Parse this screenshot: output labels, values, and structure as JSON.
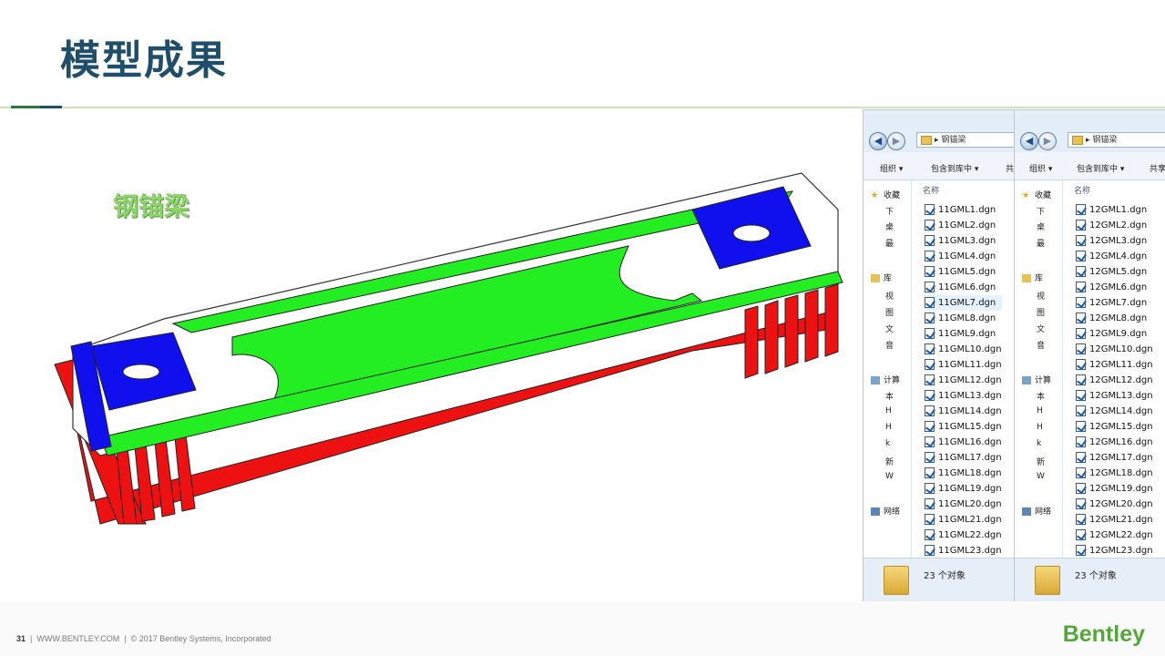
{
  "slide": {
    "title": "模型成果",
    "model_label": "钢锚梁",
    "footer": {
      "page": "31",
      "site": "WWW.BENTLEY.COM",
      "copyright": "© 2017 Bentley Systems, Incorporated"
    },
    "brand": "Bentley"
  },
  "colors": {
    "title": "#1f4e6b",
    "green_plate": "#22ee22",
    "blue_plate": "#1010ee",
    "red_ribs": "#ee1111",
    "brand_green": "#54a83b"
  },
  "windows": [
    {
      "address": "钢锚梁",
      "toolbar": [
        "组织 ▾",
        "包含到库中 ▾",
        "共"
      ],
      "column_header": "名称",
      "nav_items": [
        "收藏",
        "下",
        "桌",
        "最",
        "库",
        "视",
        "图",
        "文",
        "音",
        "计算",
        "本",
        "H",
        "H",
        "k",
        "新",
        "W",
        "网络"
      ],
      "files": [
        "11GML1.dgn",
        "11GML2.dgn",
        "11GML3.dgn",
        "11GML4.dgn",
        "11GML5.dgn",
        "11GML6.dgn",
        "11GML7.dgn",
        "11GML8.dgn",
        "11GML9.dgn",
        "11GML10.dgn",
        "11GML11.dgn",
        "11GML12.dgn",
        "11GML13.dgn",
        "11GML14.dgn",
        "11GML15.dgn",
        "11GML16.dgn",
        "11GML17.dgn",
        "11GML18.dgn",
        "11GML19.dgn",
        "11GML20.dgn",
        "11GML21.dgn",
        "11GML22.dgn",
        "11GML23.dgn"
      ],
      "selected_index": 6,
      "status": "23 个对象"
    },
    {
      "address": "钢锚梁",
      "toolbar": [
        "组织 ▾",
        "包含到库中 ▾",
        "共享"
      ],
      "column_header": "名称",
      "nav_items": [
        "收藏",
        "下",
        "桌",
        "最",
        "库",
        "视",
        "图",
        "文",
        "音",
        "计算",
        "本",
        "H",
        "H",
        "k",
        "新",
        "W",
        "网络"
      ],
      "files": [
        "12GML1.dgn",
        "12GML2.dgn",
        "12GML3.dgn",
        "12GML4.dgn",
        "12GML5.dgn",
        "12GML6.dgn",
        "12GML7.dgn",
        "12GML8.dgn",
        "12GML9.dgn",
        "12GML10.dgn",
        "12GML11.dgn",
        "12GML12.dgn",
        "12GML13.dgn",
        "12GML14.dgn",
        "12GML15.dgn",
        "12GML16.dgn",
        "12GML17.dgn",
        "12GML18.dgn",
        "12GML19.dgn",
        "12GML20.dgn",
        "12GML21.dgn",
        "12GML22.dgn",
        "12GML23.dgn"
      ],
      "selected_index": -1,
      "status": "23 个对象"
    }
  ]
}
